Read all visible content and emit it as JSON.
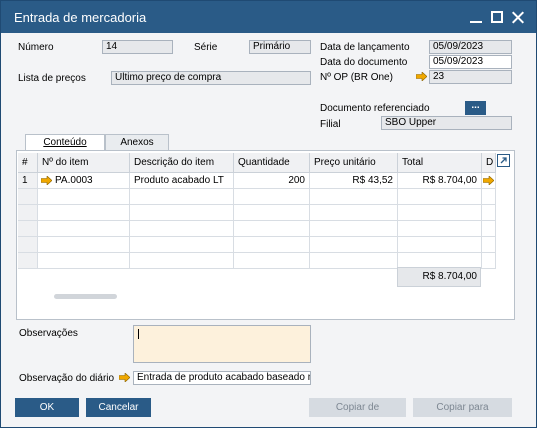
{
  "window": {
    "title": "Entrada de mercadoria"
  },
  "header": {
    "numero_label": "Número",
    "numero_value": "14",
    "serie_label": "Série",
    "serie_value": "Primário",
    "lista_precos_label": "Lista de preços",
    "lista_precos_value": "Último preço de compra",
    "data_lancamento_label": "Data de lançamento",
    "data_lancamento_value": "05/09/2023",
    "data_documento_label": "Data do documento",
    "data_documento_value": "05/09/2023",
    "no_op_label": "Nº OP (BR One)",
    "no_op_value": "23",
    "doc_referenciado_label": "Documento referenciado",
    "doc_referenciado_button": "...",
    "filial_label": "Filial",
    "filial_value": "SBO Upper"
  },
  "tabs": [
    {
      "label": "Conteúdo",
      "active": true
    },
    {
      "label": "Anexos",
      "active": false
    }
  ],
  "grid": {
    "columns": [
      "#",
      "Nº do item",
      "Descrição do item",
      "Quantidade",
      "Preço unitário",
      "Total",
      "D"
    ],
    "rows": [
      {
        "num": "1",
        "item": "PA.0003",
        "descricao": "Produto acabado LT",
        "quantidade": "200",
        "preco": "R$ 43,52",
        "total": "R$ 8.704,00"
      }
    ],
    "footer_total": "R$ 8.704,00"
  },
  "observacoes": {
    "label": "Observações",
    "value": ""
  },
  "observacao_diario": {
    "label": "Observação do diário",
    "value": "Entrada de produto acabado baseado n"
  },
  "buttons": {
    "ok": "OK",
    "cancelar": "Cancelar",
    "copiar_de": "Copiar de",
    "copiar_para": "Copiar para"
  },
  "colors": {
    "title_bar": "#2a5b87",
    "link_arrow": "#f0a800",
    "notes_bg": "#fdf1dc"
  }
}
